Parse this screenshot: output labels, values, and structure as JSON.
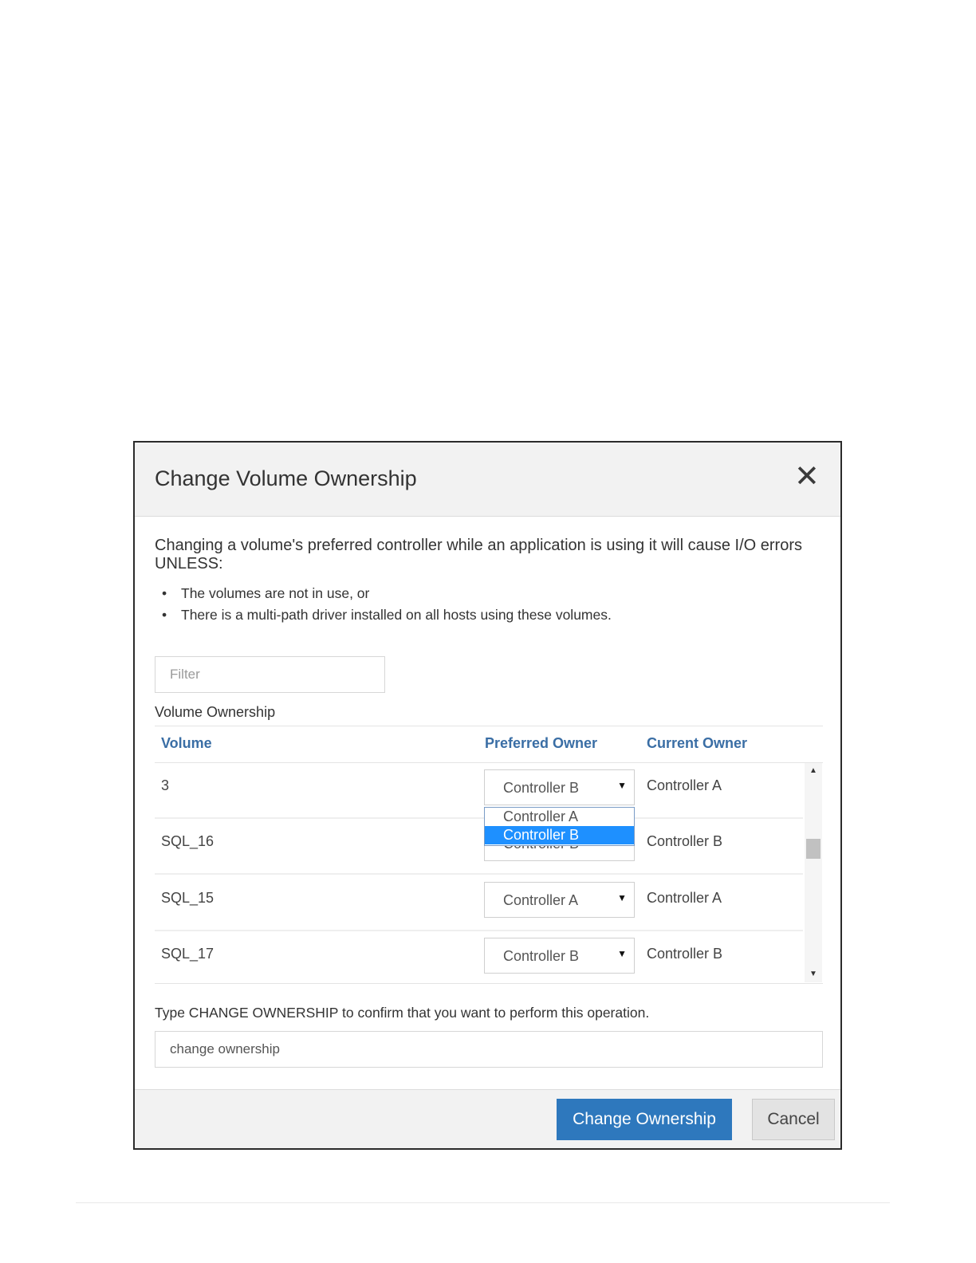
{
  "dialog": {
    "title": "Change Volume Ownership",
    "close_icon": "close-icon",
    "warning": "Changing a volume's preferred controller while an application is using it will cause I/O errors UNLESS:",
    "bullets": [
      "The volumes are not in use, or",
      "There is a multi-path driver installed on all hosts using these volumes."
    ],
    "filter": {
      "placeholder": "Filter",
      "value": ""
    },
    "section_label": "Volume Ownership",
    "table": {
      "columns": [
        "Volume",
        "Preferred Owner",
        "Current Owner"
      ],
      "rows": [
        {
          "volume": "3",
          "preferred": "Controller B",
          "current": "Controller A"
        },
        {
          "volume": "SQL_16",
          "preferred": "Controller B",
          "current": "Controller B"
        },
        {
          "volume": "SQL_15",
          "preferred": "Controller A",
          "current": "Controller A"
        },
        {
          "volume": "SQL_17",
          "preferred": "Controller B",
          "current": "Controller B"
        }
      ],
      "dropdown": {
        "options": [
          "Controller A",
          "Controller B"
        ],
        "highlighted": "Controller B"
      }
    },
    "confirm": {
      "prompt": "Type CHANGE OWNERSHIP to confirm that you want to perform this operation.",
      "value": "change ownership"
    },
    "buttons": {
      "primary": "Change Ownership",
      "cancel": "Cancel"
    },
    "colors": {
      "primary": "#2e78bd",
      "header_text": "#3a6ea5",
      "highlight": "#1e90ff"
    }
  }
}
